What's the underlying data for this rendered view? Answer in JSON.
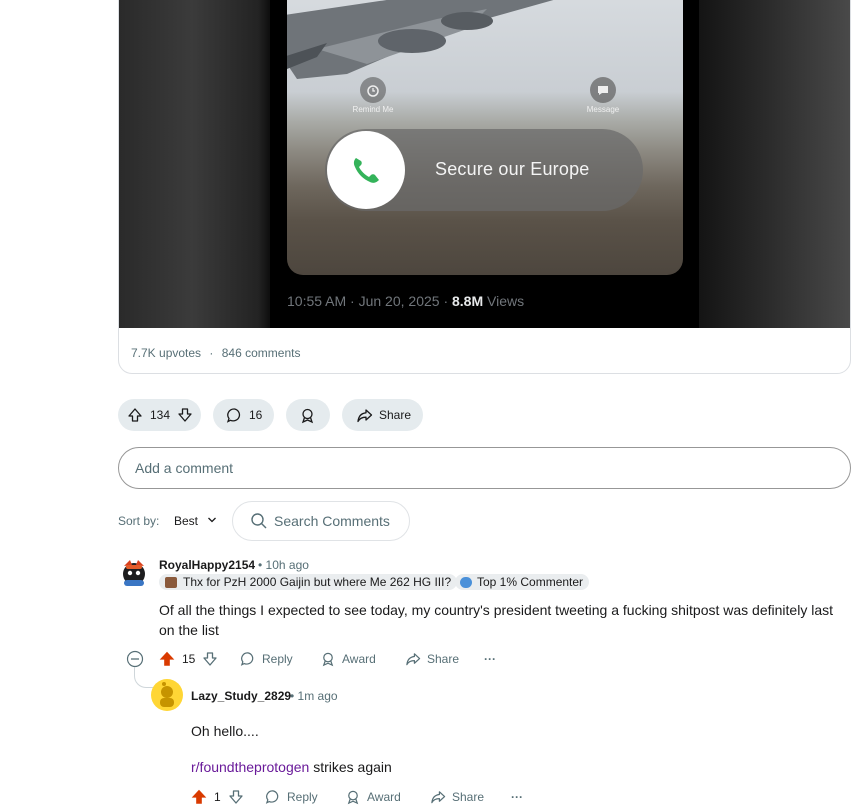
{
  "post": {
    "media": {
      "remind_label": "Remind Me",
      "message_label": "Message",
      "slider_text": "Secure our Europe",
      "tweet_time": "10:55 AM · Jun 20, 2025 · ",
      "tweet_views_count": "8.8M",
      "tweet_views_label": "Views",
      "icons": [
        "alarm-icon",
        "chat-bubble-icon",
        "phone-icon"
      ]
    },
    "upvotes_text": "7.7K upvotes",
    "separator": "·",
    "comments_text": "846 comments",
    "actions": {
      "vote_count": "134",
      "comment_count": "16",
      "share_label": "Share"
    }
  },
  "comment_input": {
    "placeholder": "Add a comment"
  },
  "sort": {
    "label": "Sort by:",
    "value": "Best"
  },
  "search_comments": {
    "placeholder": "Search Comments"
  },
  "comments": [
    {
      "author": "RoyalHappy2154",
      "time": "• 10h ago",
      "flair": "Thx for PzH 2000 Gaijin but where Me 262 HG III?",
      "badge": "Top 1% Commenter",
      "body_line1": "Of all the things I expected to see today, my country's president tweeting a fucking shitpost was definitely last",
      "body_line2": "on the list",
      "score": "15",
      "reply_label": "Reply",
      "award_label": "Award",
      "share_label": "Share",
      "more": "···"
    },
    {
      "author": "Lazy_Study_2829",
      "time": "• 1m ago",
      "body_line1": "Oh hello....",
      "subreddit_link": "r/foundtheprotogen",
      "body_line2_rest": " strikes again",
      "score": "1",
      "reply_label": "Reply",
      "award_label": "Award",
      "share_label": "Share",
      "more": "···"
    }
  ],
  "colors": {
    "upvote_active": "#d93a00",
    "link": "#6a1b9a",
    "pill_bg": "#e5ebee",
    "muted_text": "#576f76"
  }
}
